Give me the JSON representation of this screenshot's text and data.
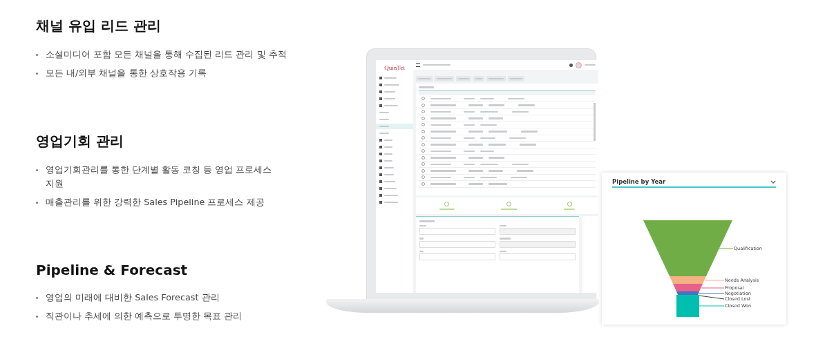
{
  "sections": [
    {
      "title": "채널 유입 리드 관리",
      "bullets": [
        "소셜미디어 포함 모든 채널을 통해 수집된 리드 관리 및 추적",
        "모든 내/외부 채널을 통한 상호작용 기록"
      ]
    },
    {
      "title": "영업기회 관리",
      "bullets": [
        "영업기회관리를 통한 단계별 활동 코칭 등 영업 프로세스 지원",
        "매출관리를 위한 강력한 Sales Pipeline 프로세스 제공"
      ]
    },
    {
      "title": "Pipeline & Forecast",
      "bullets": [
        "영업의 미래에 대비한 Sales Forecast 관리",
        "직관이나 추세에 의한 예측으로 투명한 목표 관리"
      ]
    }
  ],
  "app": {
    "logo": "QuinTet",
    "rows": [
      {
        "selected": false
      },
      {
        "selected": false
      },
      {
        "selected": false
      },
      {
        "selected": false
      },
      {
        "selected": false
      },
      {
        "selected": false
      },
      {
        "selected": false
      },
      {
        "selected": false
      },
      {
        "selected": false
      },
      {
        "selected": false
      },
      {
        "selected": false
      },
      {
        "selected": false
      },
      {
        "selected": false
      },
      {
        "selected": false
      }
    ]
  },
  "funnel": {
    "title": "Pipeline by Year",
    "segments": [
      {
        "label": "Qualification",
        "color": "#70ad47"
      },
      {
        "label": "Needs Analysis",
        "color": "#f4b183"
      },
      {
        "label": "Proposal",
        "color": "#e6608a"
      },
      {
        "label": "Negotiation",
        "color": "#4472c4"
      },
      {
        "label": "Closed Lost",
        "color": "#404040"
      },
      {
        "label": "Closed Won",
        "color": "#00bfae"
      }
    ]
  }
}
